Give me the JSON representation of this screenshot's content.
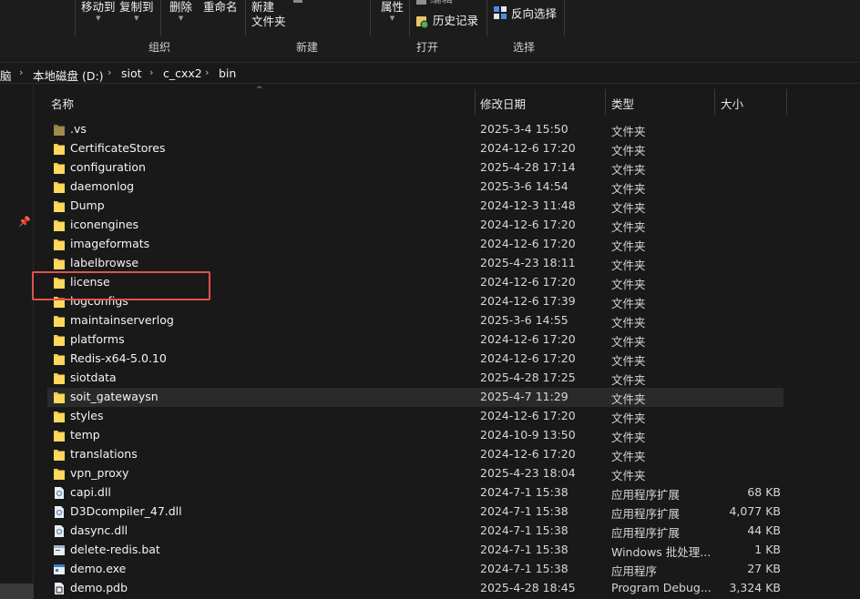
{
  "ribbon": {
    "move_to": "移动到",
    "copy_to": "复制到",
    "delete": "删除",
    "rename": "重命名",
    "new_folder_line1": "新建",
    "new_folder_line2": "文件夹",
    "properties": "属性",
    "edit": "编辑",
    "history": "历史记录",
    "invert_selection": "反向选择",
    "group_organize": "组织",
    "group_new": "新建",
    "group_open": "打开",
    "group_select": "选择"
  },
  "breadcrumb": [
    "脑",
    "本地磁盘 (D:)",
    "siot",
    "c_cxx2",
    "bin"
  ],
  "columns": {
    "name": "名称",
    "date": "修改日期",
    "type": "类型",
    "size": "大小"
  },
  "files": [
    {
      "name": ".vs",
      "date": "2025-3-4 15:50",
      "type": "文件夹",
      "size": "",
      "icon": "folder-hidden-icon"
    },
    {
      "name": "CertificateStores",
      "date": "2024-12-6 17:20",
      "type": "文件夹",
      "size": "",
      "icon": "folder-icon"
    },
    {
      "name": "configuration",
      "date": "2025-4-28 17:14",
      "type": "文件夹",
      "size": "",
      "icon": "folder-icon"
    },
    {
      "name": "daemonlog",
      "date": "2025-3-6 14:54",
      "type": "文件夹",
      "size": "",
      "icon": "folder-icon"
    },
    {
      "name": "Dump",
      "date": "2024-12-3 11:48",
      "type": "文件夹",
      "size": "",
      "icon": "folder-icon"
    },
    {
      "name": "iconengines",
      "date": "2024-12-6 17:20",
      "type": "文件夹",
      "size": "",
      "icon": "folder-icon"
    },
    {
      "name": "imageformats",
      "date": "2024-12-6 17:20",
      "type": "文件夹",
      "size": "",
      "icon": "folder-icon"
    },
    {
      "name": "labelbrowse",
      "date": "2025-4-23 18:11",
      "type": "文件夹",
      "size": "",
      "icon": "folder-icon"
    },
    {
      "name": "license",
      "date": "2024-12-6 17:20",
      "type": "文件夹",
      "size": "",
      "icon": "folder-icon"
    },
    {
      "name": "logconfigs",
      "date": "2024-12-6 17:39",
      "type": "文件夹",
      "size": "",
      "icon": "folder-icon"
    },
    {
      "name": "maintainserverlog",
      "date": "2025-3-6 14:55",
      "type": "文件夹",
      "size": "",
      "icon": "folder-icon"
    },
    {
      "name": "platforms",
      "date": "2024-12-6 17:20",
      "type": "文件夹",
      "size": "",
      "icon": "folder-icon"
    },
    {
      "name": "Redis-x64-5.0.10",
      "date": "2024-12-6 17:20",
      "type": "文件夹",
      "size": "",
      "icon": "folder-icon"
    },
    {
      "name": "siotdata",
      "date": "2025-4-28 17:25",
      "type": "文件夹",
      "size": "",
      "icon": "folder-icon"
    },
    {
      "name": "soit_gatewaysn",
      "date": "2025-4-7 11:29",
      "type": "文件夹",
      "size": "",
      "icon": "folder-icon"
    },
    {
      "name": "styles",
      "date": "2024-12-6 17:20",
      "type": "文件夹",
      "size": "",
      "icon": "folder-icon"
    },
    {
      "name": "temp",
      "date": "2024-10-9 13:50",
      "type": "文件夹",
      "size": "",
      "icon": "folder-icon"
    },
    {
      "name": "translations",
      "date": "2024-12-6 17:20",
      "type": "文件夹",
      "size": "",
      "icon": "folder-icon"
    },
    {
      "name": "vpn_proxy",
      "date": "2025-4-23 18:04",
      "type": "文件夹",
      "size": "",
      "icon": "folder-icon"
    },
    {
      "name": "capi.dll",
      "date": "2024-7-1 15:38",
      "type": "应用程序扩展",
      "size": "68 KB",
      "icon": "dll-file-icon"
    },
    {
      "name": "D3Dcompiler_47.dll",
      "date": "2024-7-1 15:38",
      "type": "应用程序扩展",
      "size": "4,077 KB",
      "icon": "dll-file-icon"
    },
    {
      "name": "dasync.dll",
      "date": "2024-7-1 15:38",
      "type": "应用程序扩展",
      "size": "44 KB",
      "icon": "dll-file-icon"
    },
    {
      "name": "delete-redis.bat",
      "date": "2024-7-1 15:38",
      "type": "Windows 批处理...",
      "size": "1 KB",
      "icon": "bat-file-icon"
    },
    {
      "name": "demo.exe",
      "date": "2024-7-1 15:38",
      "type": "应用程序",
      "size": "27 KB",
      "icon": "exe-file-icon"
    },
    {
      "name": "demo.pdb",
      "date": "2025-4-28 18:45",
      "type": "Program Debug...",
      "size": "3,324 KB",
      "icon": "pdb-file-icon"
    }
  ],
  "hovered_row": "soit_gatewaysn",
  "highlighted_row": "license",
  "colors": {
    "folder": "#f5c84c",
    "folder_hidden": "#8c7a45",
    "highlight_box": "#e0524f",
    "background": "#191919"
  }
}
